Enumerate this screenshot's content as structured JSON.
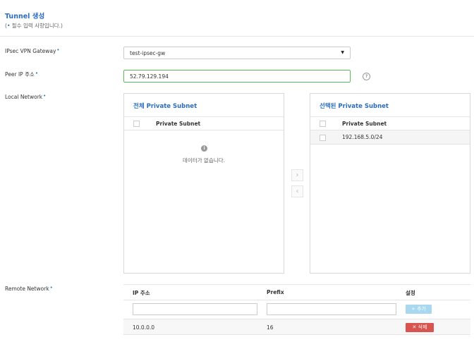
{
  "header": {
    "title": "Tunnel 생성",
    "subtitle_open": "(",
    "subtitle_dot": "•",
    "subtitle_text": " 필수 입력 사항입니다.)"
  },
  "form": {
    "gateway_label": "IPsec VPN Gateway",
    "gateway_value": "test-ipsec-gw",
    "peer_ip_label": "Peer IP 주소",
    "peer_ip_value": "52.79.129.194",
    "help_symbol": "?",
    "local_network_label": "Local Network",
    "remote_network_label": "Remote Network",
    "required_mark": "•"
  },
  "left_panel": {
    "title": "전체 Private Subnet",
    "column": "Private Subnet",
    "empty_icon": "i",
    "empty_text": "데이터가 없습니다."
  },
  "right_panel": {
    "title": "선택된 Private Subnet",
    "column": "Private Subnet",
    "rows": [
      "192.168.5.0/24"
    ]
  },
  "transfer": {
    "right_arrow": "›",
    "left_arrow": "‹"
  },
  "remote_table": {
    "col_ip": "IP 주소",
    "col_prefix": "Prefix",
    "col_setting": "설정",
    "add_label": "+ 추가",
    "rows": [
      {
        "ip": "10.0.0.0",
        "prefix": "16",
        "delete_label": "✕ 삭제"
      }
    ]
  },
  "colors": {
    "accent": "#2a6cbf",
    "valid_border": "#5cb85c",
    "add_button": "#a8d8f0",
    "delete_button": "#d9534f"
  }
}
